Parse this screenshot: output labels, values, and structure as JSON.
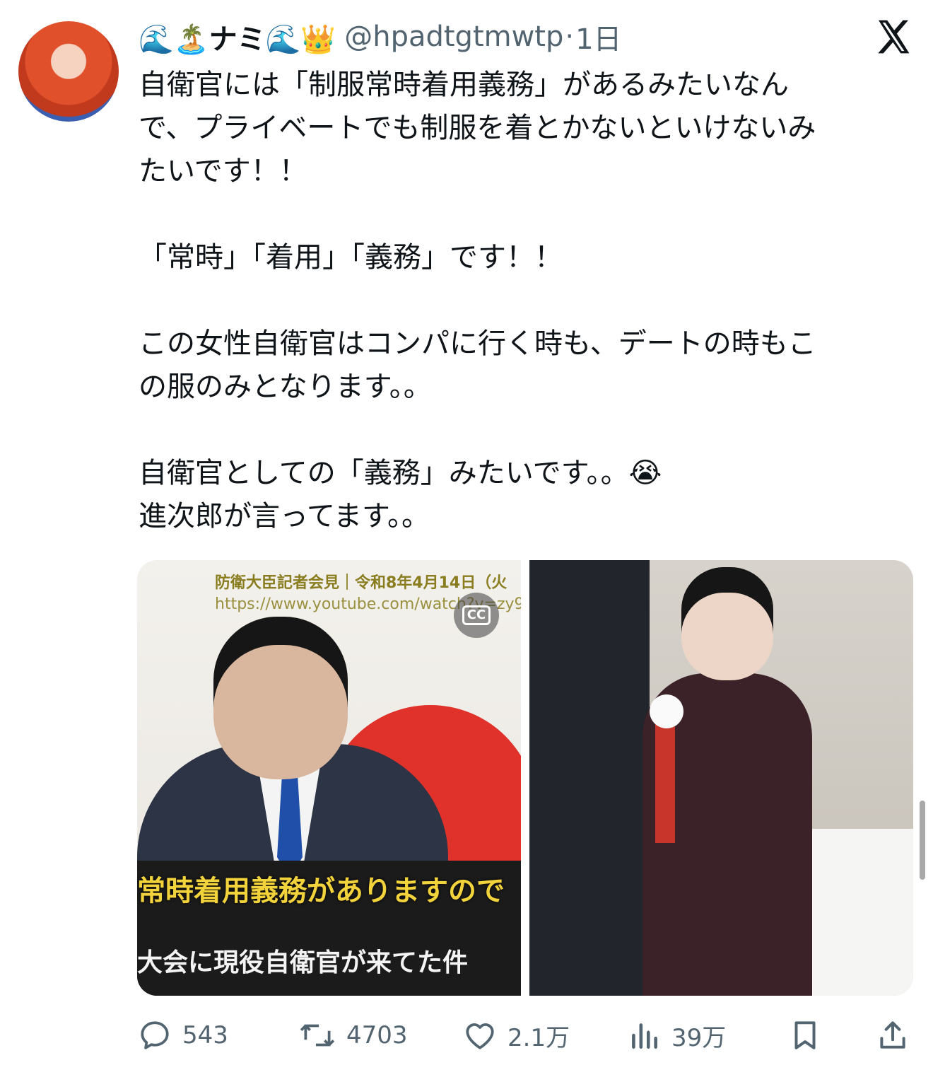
{
  "tweet": {
    "display_name": "🌊🏝️ナミ🌊👑",
    "handle": "@hpadtgtmwtp",
    "separator": "·",
    "time": "1日",
    "text": "自衛官には「制服常時着用義務」があるみたいなん\nで、プライベートでも制服を着とかないといけないみ\nたいです！！\n\n「常時」「着用」「義務」です！！\n\nこの女性自衛官はコンパに行く時も、デートの時もこ\nの服のみとなります。。\n\n自衛官としての「義務」みたいです。。😭\n進次郎が言ってます。。"
  },
  "media": {
    "left": {
      "caption_top_line1": "防衛大臣記者会見｜令和8年4月14日（火",
      "caption_top_line2": "https://www.youtube.com/watch?v=zy9",
      "cc_label": "CC",
      "subtitle_yellow": "常時着用義務がありますので",
      "subtitle_white": "大会に現役自衛官が来てた件"
    }
  },
  "actions": {
    "replies": "543",
    "reposts": "4703",
    "likes": "2.1万",
    "views": "39万"
  },
  "icons": {
    "brand": "x-logo-icon",
    "reply": "reply-icon",
    "repost": "repost-icon",
    "like": "heart-icon",
    "views": "views-icon",
    "bookmark": "bookmark-icon",
    "share": "share-icon"
  },
  "colors": {
    "text": "#0f1419",
    "secondary": "#536471"
  }
}
